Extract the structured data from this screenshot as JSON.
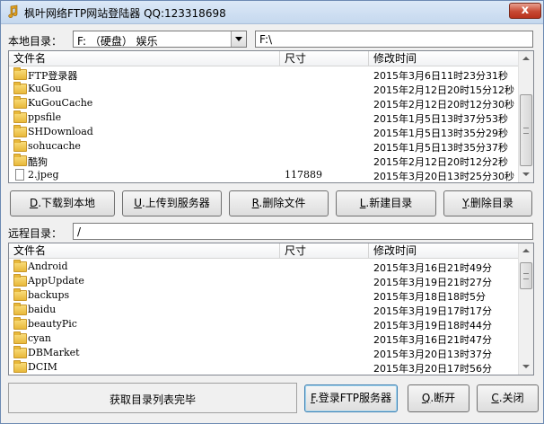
{
  "window": {
    "title": "枫叶网络FTP网站登陆器  QQ:123318698",
    "close_label": "x"
  },
  "local": {
    "label": "本地目录：",
    "drive_value": "F: （硬盘） 娱乐",
    "path_value": "F:\\",
    "columns": [
      "文件名",
      "尺寸",
      "修改时间"
    ],
    "rows": [
      {
        "name": "FTP登录器",
        "size": "",
        "time": "2015年3月6日11时23分31秒",
        "type": "folder"
      },
      {
        "name": "KuGou",
        "size": "",
        "time": "2015年2月12日20时15分12秒",
        "type": "folder"
      },
      {
        "name": "KuGouCache",
        "size": "",
        "time": "2015年2月12日20时12分30秒",
        "type": "folder"
      },
      {
        "name": "ppsfile",
        "size": "",
        "time": "2015年1月5日13时37分53秒",
        "type": "folder"
      },
      {
        "name": "SHDownload",
        "size": "",
        "time": "2015年1月5日13时35分29秒",
        "type": "folder"
      },
      {
        "name": "sohucache",
        "size": "",
        "time": "2015年1月5日13时35分37秒",
        "type": "folder"
      },
      {
        "name": "酷狗",
        "size": "",
        "time": "2015年2月12日20时12分2秒",
        "type": "folder"
      },
      {
        "name": "2.jpeg",
        "size": "117889",
        "time": "2015年3月20日13时25分30秒",
        "type": "file"
      }
    ]
  },
  "actions": [
    {
      "key": "D",
      "label": ".下载到本地"
    },
    {
      "key": "U",
      "label": ".上传到服务器"
    },
    {
      "key": "R",
      "label": ".删除文件"
    },
    {
      "key": "L",
      "label": ".新建目录"
    },
    {
      "key": "Y",
      "label": ".删除目录"
    }
  ],
  "remote": {
    "label": "远程目录：",
    "path_value": "/",
    "columns": [
      "文件名",
      "尺寸",
      "修改时间"
    ],
    "rows": [
      {
        "name": "Android",
        "size": "",
        "time": "2015年3月16日21时49分",
        "type": "folder"
      },
      {
        "name": "AppUpdate",
        "size": "",
        "time": "2015年3月19日21时27分",
        "type": "folder"
      },
      {
        "name": "backups",
        "size": "",
        "time": "2015年3月18日18时5分",
        "type": "folder"
      },
      {
        "name": "baidu",
        "size": "",
        "time": "2015年3月19日17时17分",
        "type": "folder"
      },
      {
        "name": "beautyPic",
        "size": "",
        "time": "2015年3月19日18时44分",
        "type": "folder"
      },
      {
        "name": "cyan",
        "size": "",
        "time": "2015年3月16日21时47分",
        "type": "folder"
      },
      {
        "name": "DBMarket",
        "size": "",
        "time": "2015年3月20日13时37分",
        "type": "folder"
      },
      {
        "name": "DCIM",
        "size": "",
        "time": "2015年3月20日17时56分",
        "type": "folder"
      }
    ]
  },
  "status": {
    "text": "获取目录列表完毕"
  },
  "bottom_buttons": [
    {
      "key": "F",
      "label": ".登录FTP服务器"
    },
    {
      "key": "Q",
      "label": ".断开"
    },
    {
      "key": "C",
      "label": ".关闭"
    }
  ]
}
